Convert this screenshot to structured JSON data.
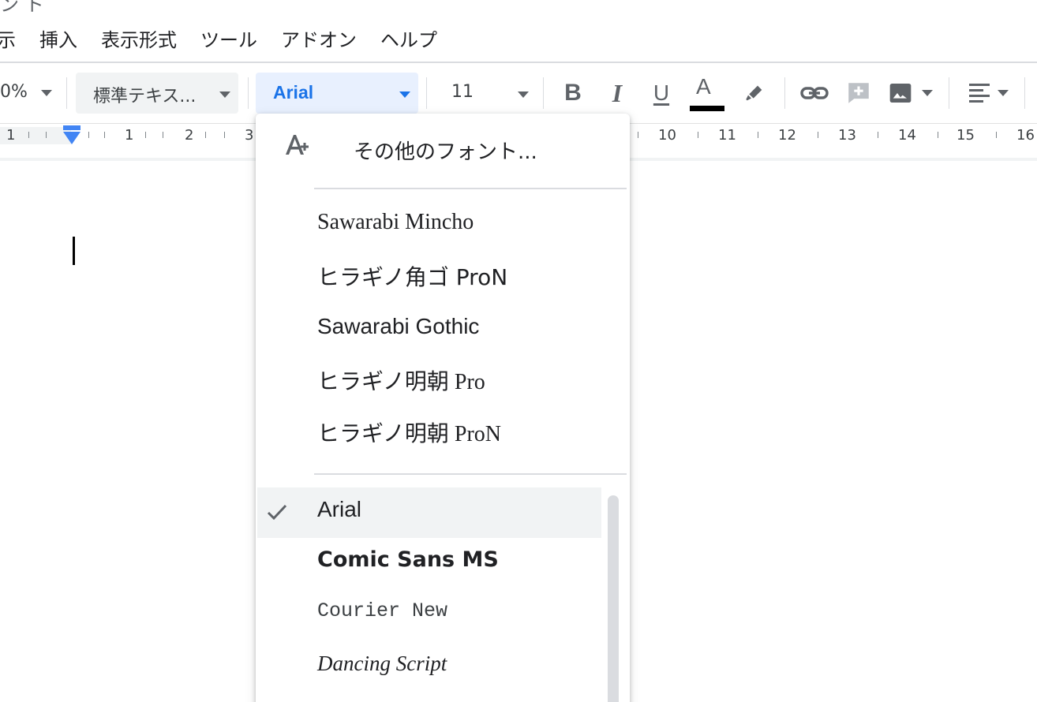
{
  "title_fragment": "ン ト",
  "menu": {
    "items": [
      {
        "label": "示"
      },
      {
        "label": "挿入"
      },
      {
        "label": "表示形式"
      },
      {
        "label": "ツール"
      },
      {
        "label": "アドオン"
      },
      {
        "label": "ヘルプ"
      }
    ]
  },
  "toolbar": {
    "zoom": "0%",
    "style": "標準テキス...",
    "font": "Arial",
    "size": "11",
    "bold_glyph": "B",
    "italic_glyph": "I",
    "underline_glyph": "U",
    "textcolor_glyph": "A"
  },
  "ruler": {
    "numbers": [
      "1",
      "1",
      "2",
      "3",
      "10",
      "11",
      "12",
      "13",
      "14",
      "15",
      "16"
    ]
  },
  "font_menu": {
    "more_fonts_label": "その他のフォント...",
    "recent_fonts": [
      {
        "label": "Sawarabi Mincho"
      },
      {
        "label": "ヒラギノ角ゴ ProN"
      },
      {
        "label": "Sawarabi Gothic"
      },
      {
        "label": "ヒラギノ明朝 Pro"
      },
      {
        "label": "ヒラギノ明朝 ProN"
      }
    ],
    "all_fonts": [
      {
        "label": "Arial",
        "selected": true
      },
      {
        "label": "Comic Sans MS",
        "selected": false
      },
      {
        "label": "Courier New",
        "selected": false
      },
      {
        "label": "Dancing Script",
        "selected": false
      }
    ]
  },
  "colors": {
    "accent": "#1a73e8",
    "font_box_bg": "#e8f0fe",
    "text_color_bar": "#000000"
  }
}
